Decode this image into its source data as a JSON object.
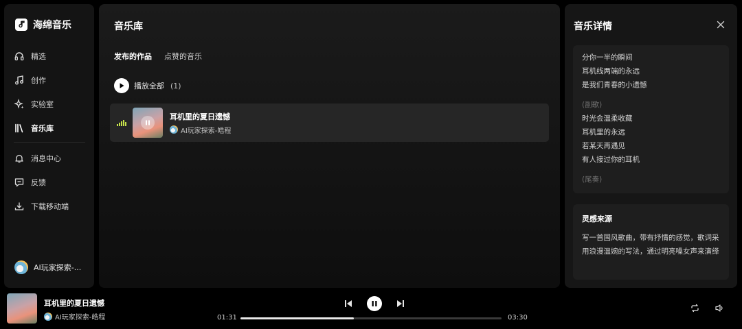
{
  "app": {
    "name": "海绵音乐"
  },
  "sidebar": {
    "items": [
      {
        "label": "精选",
        "icon": "headphones-icon"
      },
      {
        "label": "创作",
        "icon": "music-note-icon"
      },
      {
        "label": "实验室",
        "icon": "sparkle-icon"
      },
      {
        "label": "音乐库",
        "icon": "library-icon"
      },
      {
        "label": "消息中心",
        "icon": "bell-icon"
      },
      {
        "label": "反馈",
        "icon": "feedback-icon"
      },
      {
        "label": "下载移动端",
        "icon": "download-icon"
      }
    ],
    "active": "音乐库",
    "user": {
      "name": "AI玩家探索-..."
    }
  },
  "main": {
    "title": "音乐库",
    "tabs": [
      {
        "label": "发布的作品"
      },
      {
        "label": "点赞的音乐"
      }
    ],
    "active_tab": "发布的作品",
    "play_all": {
      "label": "播放全部",
      "count": "(1)"
    },
    "tracks": [
      {
        "title": "耳机里的夏日遗憾",
        "artist": "AI玩家探索-皓程"
      }
    ]
  },
  "detail": {
    "title": "音乐详情",
    "lyrics": [
      {
        "text": "分你一半的瞬间",
        "type": "line"
      },
      {
        "text": "耳机线两端的永远",
        "type": "line"
      },
      {
        "text": "是我们青春的小遗憾",
        "type": "line"
      },
      {
        "text": "",
        "type": "gap"
      },
      {
        "text": "(副歌)",
        "type": "section"
      },
      {
        "text": "时光会温柔收藏",
        "type": "line"
      },
      {
        "text": "耳机里的永远",
        "type": "line"
      },
      {
        "text": "若某天再遇见",
        "type": "line"
      },
      {
        "text": "有人接过你的耳机",
        "type": "line"
      },
      {
        "text": "",
        "type": "gap"
      },
      {
        "text": "(尾奏)",
        "type": "section"
      }
    ],
    "inspiration": {
      "title": "灵感来源",
      "text": "写一首国风歌曲，带有抒情的感觉，歌词采用浪漫温婉的写法，通过明亮嗓女声来演绎"
    }
  },
  "player": {
    "title": "耳机里的夏日遗憾",
    "artist": "AI玩家探索-皓程",
    "current_time": "01:31",
    "total_time": "03:30",
    "progress": 0.433
  }
}
